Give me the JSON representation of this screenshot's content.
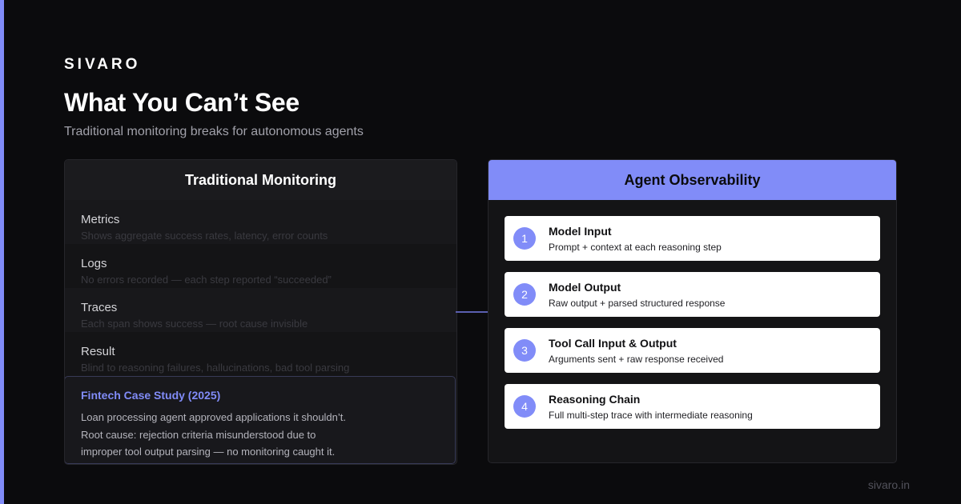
{
  "brand": "SIVARO",
  "title": "What You Can’t See",
  "subtitle": "Traditional monitoring breaks for autonomous agents",
  "traditional": {
    "header": "Traditional Monitoring",
    "rows": [
      {
        "name": "Metrics",
        "desc": "Shows aggregate success rates, latency, error counts"
      },
      {
        "name": "Logs",
        "desc": "No errors recorded — each step reported “succeeded”"
      },
      {
        "name": "Traces",
        "desc": "Each span shows success — root cause invisible"
      },
      {
        "name": "Result",
        "desc": "Blind to reasoning failures, hallucinations, bad tool parsing"
      }
    ]
  },
  "case_study": {
    "title": "Fintech Case Study (2025)",
    "line1": "Loan processing agent approved applications it shouldn’t.",
    "line2": "Root cause: rejection criteria misunderstood due to",
    "line3": "improper tool output parsing — no monitoring caught it."
  },
  "observability": {
    "header": "Agent Observability",
    "items": [
      {
        "num": "1",
        "name": "Model Input",
        "desc": "Prompt + context at each reasoning step"
      },
      {
        "num": "2",
        "name": "Model Output",
        "desc": "Raw output + parsed structured response"
      },
      {
        "num": "3",
        "name": "Tool Call Input & Output",
        "desc": "Arguments sent + raw response received"
      },
      {
        "num": "4",
        "name": "Reasoning Chain",
        "desc": "Full multi-step trace with intermediate reasoning"
      }
    ]
  },
  "footer": "sivaro.in",
  "colors": {
    "background": "#0b0b0d",
    "accent": "#818cf8",
    "panel": "#141416",
    "card": "#ffffff"
  },
  "icons": {
    "arrow": "arrow-right-icon"
  }
}
